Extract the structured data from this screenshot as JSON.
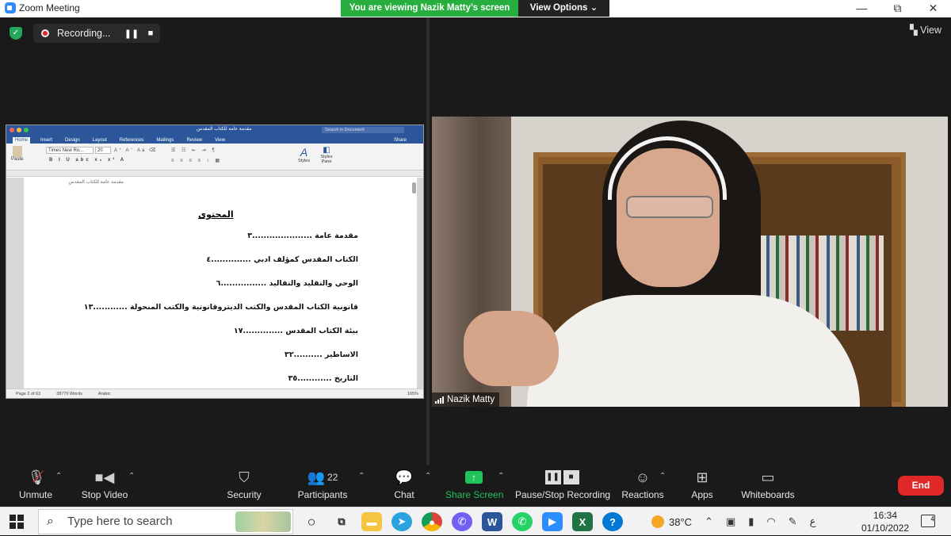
{
  "titlebar": {
    "app_title": "Zoom Meeting",
    "banner": "You are viewing Nazik Matty’s screen",
    "view_options": "View Options ⌄",
    "min": "—",
    "restore": "⧉",
    "close": "✕"
  },
  "meeting": {
    "recording_label": "Recording...",
    "view_label": "View"
  },
  "word": {
    "doc_title": "مقدمة عامة للكتاب المقدس",
    "search_placeholder": "Search in Document",
    "tabs": [
      "Home",
      "Insert",
      "Design",
      "Layout",
      "References",
      "Mailings",
      "Review",
      "View"
    ],
    "share_label": "Share",
    "font_name": "Times New Ro...",
    "font_size": "20",
    "styles_label": "Styles",
    "styles_pane_label": "Styles Pane",
    "paste_label": "Paste",
    "header_note": "مقدمة عامة للكتاب المقدس",
    "toc_title": "المحتوى",
    "toc_lines": [
      "مقدمة عامة .....................٣",
      "الكتاب المقدس كمؤلف ادبي ..............٤",
      "الوحي والتقليد والتقاليد ................٦",
      "قانونية الكتاب المقدس والكتب الديتروقانونية والكتب المنحولة ............١٣",
      "بيئة الكتاب المقدس ..............١٧",
      "الاساطير ..........٣٢",
      "التاريخ ............٣٥"
    ],
    "status_page": "Page 2 of 63",
    "status_words": "38770 Words",
    "status_lang": "Arabic",
    "status_zoom": "165%"
  },
  "video": {
    "participant_name": "Nazik Matty"
  },
  "toolbar": {
    "unmute": "Unmute",
    "stop_video": "Stop Video",
    "security": "Security",
    "participants": "Participants",
    "participants_count": "22",
    "chat": "Chat",
    "share_screen": "Share Screen",
    "pause_stop_recording": "Pause/Stop Recording",
    "reactions": "Reactions",
    "apps": "Apps",
    "whiteboards": "Whiteboards",
    "end": "End"
  },
  "taskbar": {
    "search_placeholder": "Type here to search",
    "temperature": "38°C",
    "time": "16:34",
    "date": "01/10/2022",
    "lang": "ع",
    "notification_count": "4"
  },
  "colors": {
    "banner_green": "#27ae3f",
    "end_red": "#e02828",
    "word_blue": "#2b579a",
    "share_green": "#1fc25b"
  }
}
